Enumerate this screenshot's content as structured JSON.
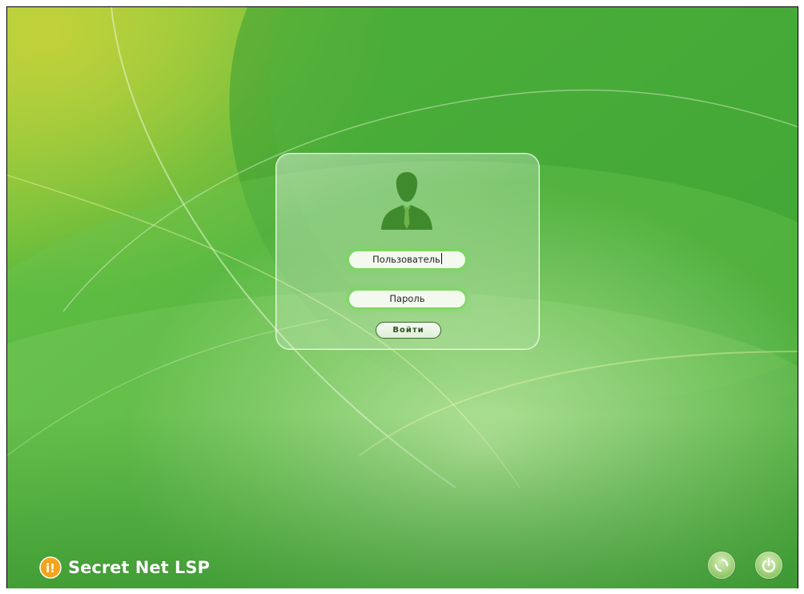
{
  "login": {
    "username_value": "Пользователь",
    "password_placeholder": "Пароль",
    "submit_label": "Войти"
  },
  "branding": {
    "product_name": "Secret Net LSP"
  },
  "footer_buttons": {
    "refresh_icon": "refresh-icon",
    "power_icon": "power-icon"
  },
  "colors": {
    "wallpaper_green": "#3ea233",
    "field_glow": "#7fd660",
    "avatar": "#3f8a2d"
  }
}
